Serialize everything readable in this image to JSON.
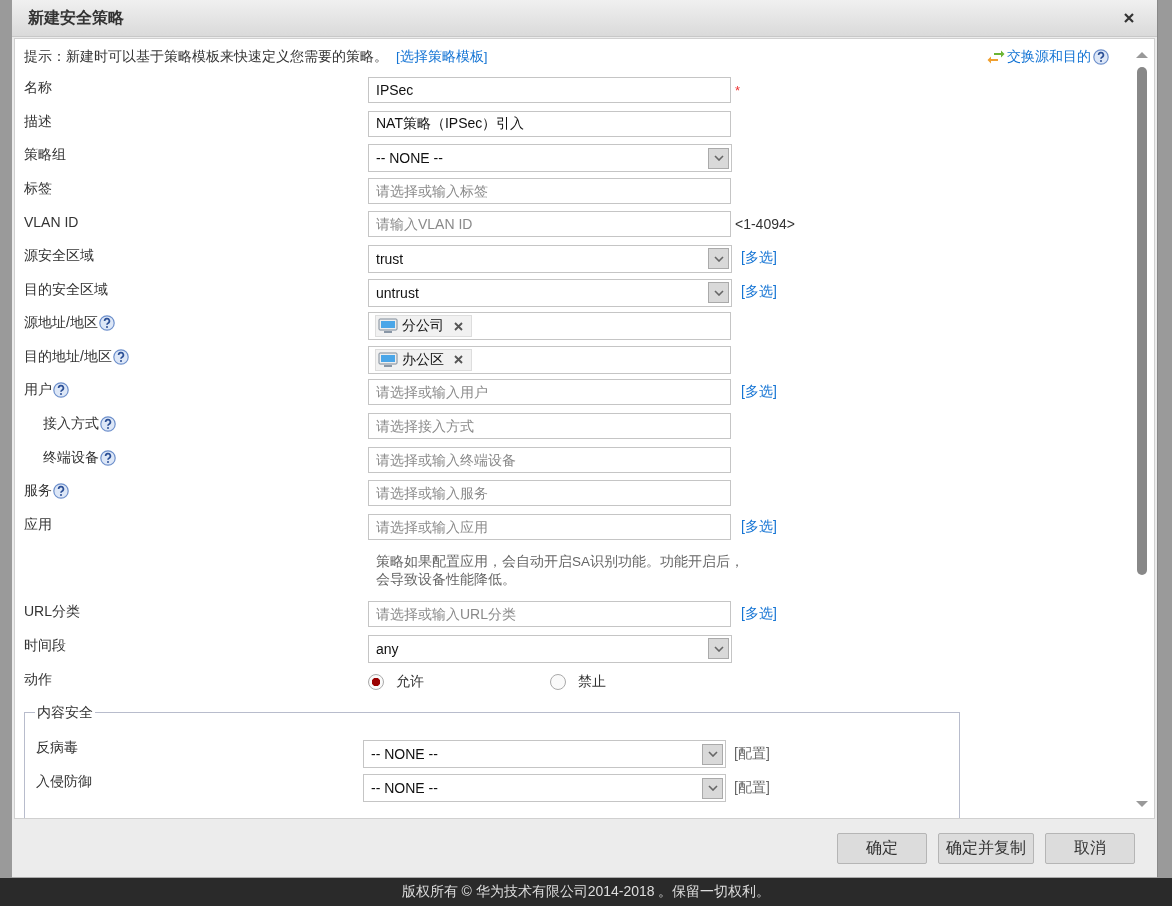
{
  "dialog": {
    "title": "新建安全策略",
    "tip": {
      "text": "提示：新建时可以基于策略模板来快速定义您需要的策略。",
      "link": "[选择策略模板]"
    },
    "swap_link": "交换源和目的",
    "fields": [
      {
        "kind": "text",
        "label": "名称",
        "value": "IPSec",
        "required_mark": "*"
      },
      {
        "kind": "text",
        "label": "描述",
        "value": "NAT策略（IPSec）引入"
      },
      {
        "kind": "select",
        "label": "策略组",
        "value": "-- NONE --"
      },
      {
        "kind": "text",
        "label": "标签",
        "placeholder": "请选择或输入标签"
      },
      {
        "kind": "text",
        "label": "VLAN ID",
        "placeholder": "请输入VLAN ID",
        "suffix": "<1-4094>"
      },
      {
        "kind": "select",
        "label": "源安全区域",
        "value": "trust",
        "link": "[多选]"
      },
      {
        "kind": "select",
        "label": "目的安全区域",
        "value": "untrust",
        "link": "[多选]"
      },
      {
        "kind": "tags",
        "label": "源地址/地区",
        "help": true,
        "tags": [
          "分公司"
        ]
      },
      {
        "kind": "tags",
        "label": "目的地址/地区",
        "help": true,
        "tags": [
          "办公区"
        ]
      },
      {
        "kind": "text",
        "label": "用户",
        "help": true,
        "placeholder": "请选择或输入用户",
        "link": "[多选]",
        "children": [
          {
            "kind": "text",
            "label": "接入方式",
            "help": true,
            "placeholder": "请选择接入方式"
          },
          {
            "kind": "text",
            "label": "终端设备",
            "help": true,
            "placeholder": "请选择或输入终端设备"
          }
        ]
      },
      {
        "kind": "text",
        "label": "服务",
        "help": true,
        "placeholder": "请选择或输入服务"
      },
      {
        "kind": "text",
        "label": "应用",
        "placeholder": "请选择或输入应用",
        "link": "[多选]",
        "note": "策略如果配置应用，会自动开启SA识别功能。功能开启后，会导致设备性能降低。"
      },
      {
        "kind": "text",
        "label": "URL分类",
        "placeholder": "请选择或输入URL分类",
        "link": "[多选]"
      },
      {
        "kind": "select",
        "label": "时间段",
        "value": "any"
      },
      {
        "kind": "radio",
        "label": "动作",
        "options": [
          {
            "label": "允许",
            "selected": true
          },
          {
            "label": "禁止",
            "selected": false
          }
        ]
      }
    ],
    "content_security": {
      "legend": "内容安全",
      "rows": [
        {
          "label": "反病毒",
          "value": "-- NONE --",
          "link": "[配置]"
        },
        {
          "label": "入侵防御",
          "value": "-- NONE --",
          "link": "[配置]"
        }
      ]
    },
    "buttons": [
      "确定",
      "确定并复制",
      "取消"
    ]
  },
  "copyright": "版权所有 © 华为技术有限公司2014-2018 。保留一切权利。"
}
